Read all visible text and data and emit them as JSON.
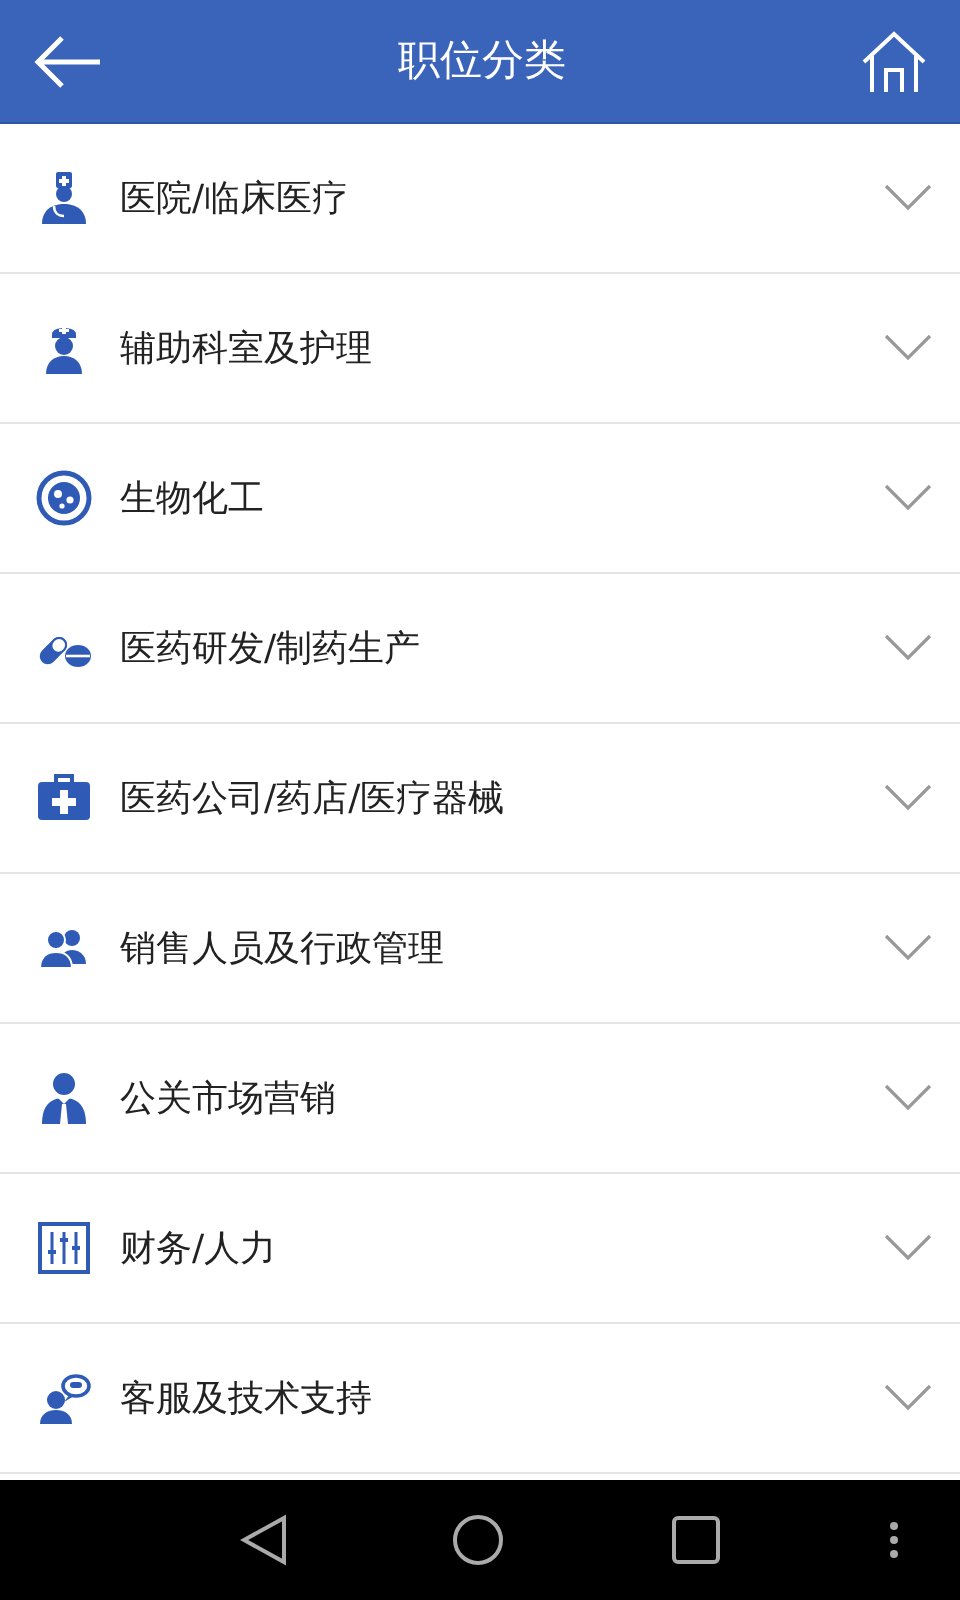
{
  "header": {
    "title": "职位分类"
  },
  "categories": [
    {
      "label": "医院/临床医疗",
      "kind": "doctor",
      "expanded": false
    },
    {
      "label": "辅助科室及护理",
      "kind": "nurse",
      "expanded": false
    },
    {
      "label": "生物化工",
      "kind": "cell",
      "expanded": false
    },
    {
      "label": "医药研发/制药生产",
      "kind": "pills",
      "expanded": false
    },
    {
      "label": "医药公司/药店/医疗器械",
      "kind": "medkit",
      "expanded": false
    },
    {
      "label": "销售人员及行政管理",
      "kind": "people",
      "expanded": false
    },
    {
      "label": "公关市场营销",
      "kind": "manager",
      "expanded": false
    },
    {
      "label": "财务/人力",
      "kind": "sliders",
      "expanded": false
    },
    {
      "label": "客服及技术支持",
      "kind": "support",
      "expanded": false
    }
  ]
}
